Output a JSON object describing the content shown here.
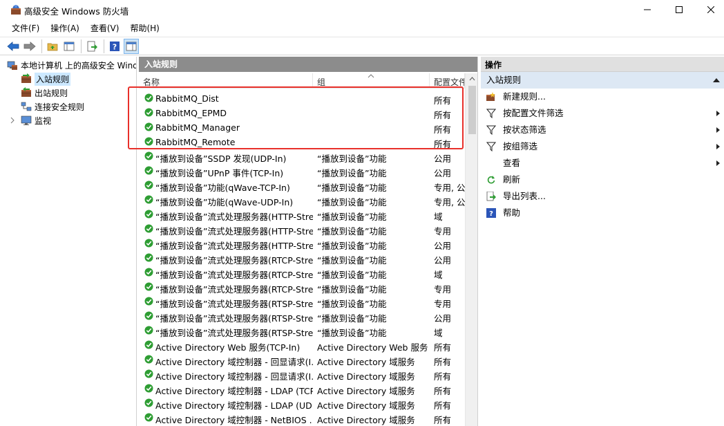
{
  "window": {
    "title": "高级安全 Windows 防火墙"
  },
  "menu": [
    "文件(F)",
    "操作(A)",
    "查看(V)",
    "帮助(H)"
  ],
  "tree": {
    "root": "本地计算机 上的高级安全 Wind",
    "items": [
      "入站规则",
      "出站规则",
      "连接安全规则",
      "监视"
    ]
  },
  "center": {
    "header": "入站规则",
    "columns": [
      "名称",
      "组",
      "配置文件"
    ],
    "rows": [
      {
        "name": "RabbitMQ_Dist",
        "group": "",
        "profile": "所有"
      },
      {
        "name": "RabbitMQ_EPMD",
        "group": "",
        "profile": "所有"
      },
      {
        "name": "RabbitMQ_Manager",
        "group": "",
        "profile": "所有"
      },
      {
        "name": "RabbitMQ_Remote",
        "group": "",
        "profile": "所有"
      },
      {
        "name": "“播放到设备”SSDP 发现(UDP-In)",
        "group": "“播放到设备”功能",
        "profile": "公用"
      },
      {
        "name": "“播放到设备”UPnP 事件(TCP-In)",
        "group": "“播放到设备”功能",
        "profile": "公用"
      },
      {
        "name": "“播放到设备”功能(qWave-TCP-In)",
        "group": "“播放到设备”功能",
        "profile": "专用, 公"
      },
      {
        "name": "“播放到设备”功能(qWave-UDP-In)",
        "group": "“播放到设备”功能",
        "profile": "专用, 公"
      },
      {
        "name": "“播放到设备”流式处理服务器(HTTP-Stre...",
        "group": "“播放到设备”功能",
        "profile": "域"
      },
      {
        "name": "“播放到设备”流式处理服务器(HTTP-Stre...",
        "group": "“播放到设备”功能",
        "profile": "专用"
      },
      {
        "name": "“播放到设备”流式处理服务器(HTTP-Stre...",
        "group": "“播放到设备”功能",
        "profile": "公用"
      },
      {
        "name": "“播放到设备”流式处理服务器(RTCP-Stre...",
        "group": "“播放到设备”功能",
        "profile": "公用"
      },
      {
        "name": "“播放到设备”流式处理服务器(RTCP-Stre...",
        "group": "“播放到设备”功能",
        "profile": "域"
      },
      {
        "name": "“播放到设备”流式处理服务器(RTCP-Stre...",
        "group": "“播放到设备”功能",
        "profile": "专用"
      },
      {
        "name": "“播放到设备”流式处理服务器(RTSP-Stre...",
        "group": "“播放到设备”功能",
        "profile": "专用"
      },
      {
        "name": "“播放到设备”流式处理服务器(RTSP-Stre...",
        "group": "“播放到设备”功能",
        "profile": "公用"
      },
      {
        "name": "“播放到设备”流式处理服务器(RTSP-Stre...",
        "group": "“播放到设备”功能",
        "profile": "域"
      },
      {
        "name": "Active Directory Web 服务(TCP-In)",
        "group": "Active Directory Web 服务",
        "profile": "所有"
      },
      {
        "name": "Active Directory 域控制器 - 回显请求(I...",
        "group": "Active Directory 域服务",
        "profile": "所有"
      },
      {
        "name": "Active Directory 域控制器 - 回显请求(I...",
        "group": "Active Directory 域服务",
        "profile": "所有"
      },
      {
        "name": "Active Directory 域控制器 - LDAP (TCP...",
        "group": "Active Directory 域服务",
        "profile": "所有"
      },
      {
        "name": "Active Directory 域控制器 - LDAP (UD...",
        "group": "Active Directory 域服务",
        "profile": "所有"
      },
      {
        "name": "Active Directory 域控制器 - NetBIOS ...",
        "group": "Active Directory 域服务",
        "profile": "所有"
      }
    ]
  },
  "actions": {
    "header": "操作",
    "section": "入站规则",
    "items": [
      {
        "label": "新建规则...",
        "icon": "new-rule-icon",
        "submenu": false
      },
      {
        "label": "按配置文件筛选",
        "icon": "filter-icon",
        "submenu": true
      },
      {
        "label": "按状态筛选",
        "icon": "filter-icon",
        "submenu": true
      },
      {
        "label": "按组筛选",
        "icon": "filter-icon",
        "submenu": true
      },
      {
        "label": "查看",
        "icon": "",
        "submenu": true
      },
      {
        "label": "刷新",
        "icon": "refresh-icon",
        "submenu": false
      },
      {
        "label": "导出列表...",
        "icon": "export-icon",
        "submenu": false
      },
      {
        "label": "帮助",
        "icon": "help-icon",
        "submenu": false
      }
    ]
  },
  "colors": {
    "header_gray": "#8c8c8c",
    "selection": "#cce8ff",
    "highlight_red": "#e8302a",
    "enabled_green": "#2e9d33"
  }
}
